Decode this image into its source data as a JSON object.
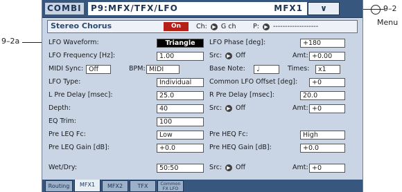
{
  "header": {
    "mode": "COMBI",
    "page_title": "P9:MFX/TFX/LFO",
    "bank": "MFX1",
    "menu_glyph": "∨"
  },
  "callouts": {
    "menu_ref": "9–2",
    "menu_word": "Menu",
    "waveform_ref": "9–2a"
  },
  "effect": {
    "name": "Stereo Chorus",
    "on_label": "On",
    "ch_label": "Ch:",
    "ch_value": "G ch",
    "p_label": "P:",
    "p_value": "-------------------"
  },
  "params": {
    "lfo_waveform_label": "LFO Waveform:",
    "lfo_waveform_value": "Triangle",
    "lfo_phase_label": "LFO Phase [deg]:",
    "lfo_phase_value": "+180",
    "lfo_freq_label": "LFO Frequency [Hz]:",
    "lfo_freq_value": "1.00",
    "src1_label": "Src:",
    "src1_value": "Off",
    "amt1_label": "Amt:",
    "amt1_value": "+0.00",
    "midi_sync_label": "MIDI Sync:",
    "midi_sync_value": "Off",
    "bpm_label": "BPM:",
    "bpm_value": "MIDI",
    "base_note_label": "Base Note:",
    "base_note_value": "♩",
    "times_label": "Times:",
    "times_value": "x1",
    "lfo_type_label": "LFO Type:",
    "lfo_type_value": "Individual",
    "common_offset_label": "Common LFO Offset [deg]:",
    "common_offset_value": "+0",
    "l_pre_delay_label": "L Pre Delay [msec]:",
    "l_pre_delay_value": "25.0",
    "r_pre_delay_label": "R Pre Delay [msec]:",
    "r_pre_delay_value": "20.0",
    "depth_label": "Depth:",
    "depth_value": "40",
    "src2_label": "Src:",
    "src2_value": "Off",
    "amt2_label": "Amt:",
    "amt2_value": "+0",
    "eq_trim_label": "EQ Trim:",
    "eq_trim_value": "100",
    "pre_leq_fc_label": "Pre LEQ Fc:",
    "pre_leq_fc_value": "Low",
    "pre_heq_fc_label": "Pre HEQ Fc:",
    "pre_heq_fc_value": "High",
    "pre_leq_gain_label": "Pre LEQ Gain [dB]:",
    "pre_leq_gain_value": "+0.0",
    "pre_heq_gain_label": "Pre HEQ Gain [dB]:",
    "pre_heq_gain_value": "+0.0",
    "wet_dry_label": "Wet/Dry:",
    "wet_dry_value": "50:50",
    "src3_label": "Src:",
    "src3_value": "Off",
    "amt3_label": "Amt:",
    "amt3_value": "+0"
  },
  "tabs": {
    "routing": "Routing",
    "mfx1": "MFX1",
    "mfx2": "MFX2",
    "tfx": "TFX",
    "common_lfo_1": "Common",
    "common_lfo_2": "FX LFO"
  },
  "colors": {
    "title_bar": "#37577f",
    "panel_bg": "#c9d5e5",
    "on_button": "#b52019",
    "selected_field": "#000000"
  }
}
